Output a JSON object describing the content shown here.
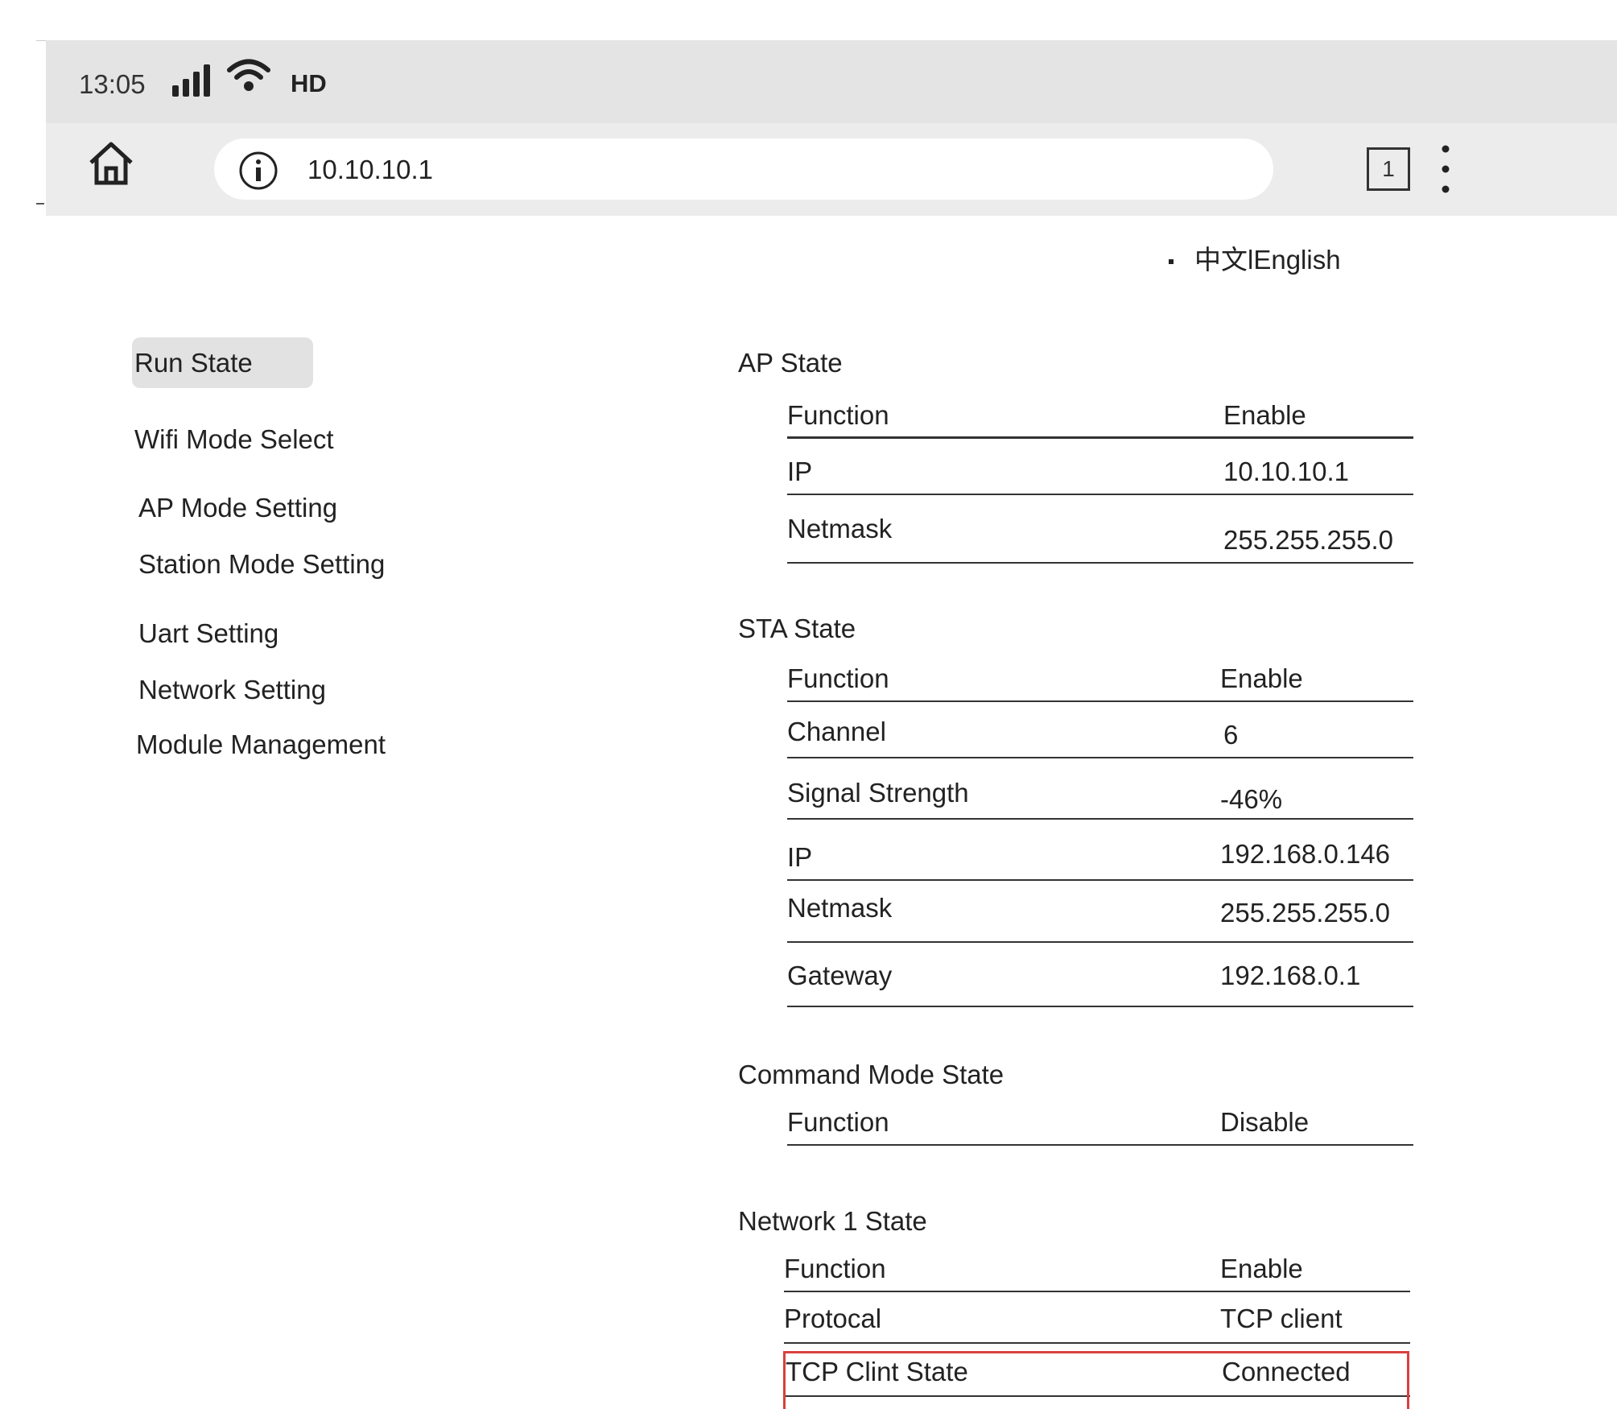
{
  "status_bar": {
    "time": "13:05",
    "network": "HD"
  },
  "browser": {
    "url": "10.10.10.1",
    "tab_count": "1"
  },
  "language": {
    "zh": "中文",
    "en": "English"
  },
  "sidebar": {
    "items": [
      {
        "label": "Run State",
        "active": true
      },
      {
        "label": "Wifi Mode Select"
      },
      {
        "label": "AP Mode Setting"
      },
      {
        "label": "Station Mode Setting"
      },
      {
        "label": "Uart Setting"
      },
      {
        "label": "Network Setting"
      },
      {
        "label": "Module Management"
      }
    ]
  },
  "sections": [
    {
      "title": "AP State",
      "rows": [
        {
          "key": "Function",
          "value": "Enable"
        },
        {
          "key": "IP",
          "value": "10.10.10.1"
        },
        {
          "key": "Netmask",
          "value": "255.255.255.0"
        }
      ]
    },
    {
      "title": "STA State",
      "rows": [
        {
          "key": "Function",
          "value": "Enable"
        },
        {
          "key": "Channel",
          "value": "6"
        },
        {
          "key": "Signal Strength",
          "value": "-46%"
        },
        {
          "key": "IP",
          "value": "192.168.0.146"
        },
        {
          "key": "Netmask",
          "value": "255.255.255.0"
        },
        {
          "key": "Gateway",
          "value": "192.168.0.1"
        }
      ]
    },
    {
      "title": "Command Mode State",
      "rows": [
        {
          "key": "Function",
          "value": "Disable"
        }
      ]
    },
    {
      "title": "Network 1 State",
      "rows": [
        {
          "key": "Function",
          "value": "Enable"
        },
        {
          "key": "Protocal",
          "value": "TCP client"
        },
        {
          "key": "TCP Clint State",
          "value": "Connected"
        }
      ]
    }
  ],
  "colors": {
    "highlight": "#d94040",
    "status_bar_bg": "#e4e4e4",
    "active_nav_bg": "#e2e2e2"
  }
}
